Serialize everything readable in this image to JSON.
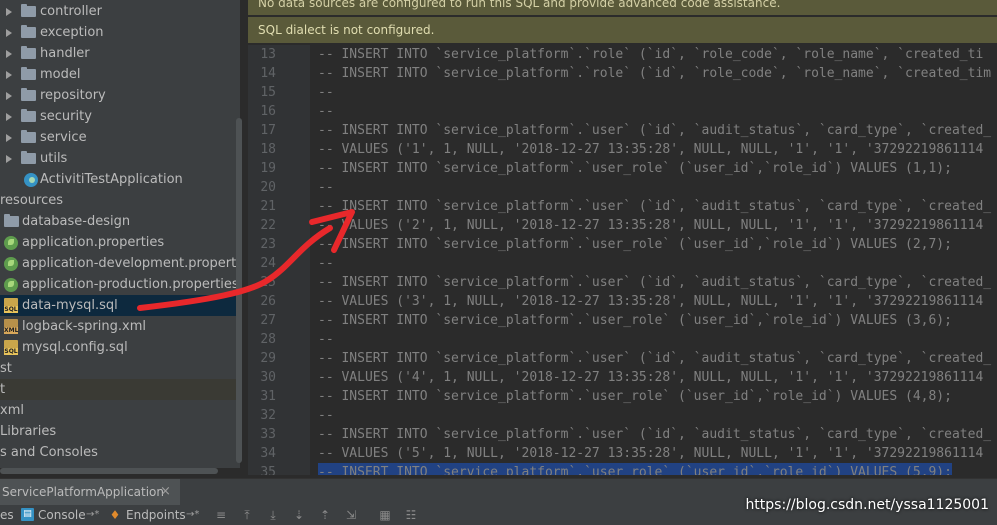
{
  "tree": {
    "items": [
      {
        "label": "controller",
        "icon": "folder",
        "arrow": true
      },
      {
        "label": "exception",
        "icon": "folder",
        "arrow": true
      },
      {
        "label": "handler",
        "icon": "folder",
        "arrow": true
      },
      {
        "label": "model",
        "icon": "folder",
        "arrow": true
      },
      {
        "label": "repository",
        "icon": "folder",
        "arrow": true
      },
      {
        "label": "security",
        "icon": "folder",
        "arrow": true
      },
      {
        "label": "service",
        "icon": "folder",
        "arrow": true
      },
      {
        "label": "utils",
        "icon": "folder",
        "arrow": true
      },
      {
        "label": "ActivitiTestApplication",
        "icon": "spring-class"
      },
      {
        "label": "resources",
        "icon": "none"
      },
      {
        "label": "database-design",
        "icon": "folder"
      },
      {
        "label": "application.properties",
        "icon": "spring-leaf"
      },
      {
        "label": "application-development.properties",
        "icon": "spring-leaf"
      },
      {
        "label": "application-production.properties",
        "icon": "spring-leaf"
      },
      {
        "label": "data-mysql.sql",
        "icon": "sql",
        "selected": true
      },
      {
        "label": "logback-spring.xml",
        "icon": "xml"
      },
      {
        "label": "mysql.config.sql",
        "icon": "sql"
      },
      {
        "label": "st",
        "icon": "none"
      },
      {
        "label": "t",
        "icon": "none",
        "highlight": true
      },
      {
        "label": "xml",
        "icon": "none"
      },
      {
        "label": "Libraries",
        "icon": "none"
      },
      {
        "label": "s and Consoles",
        "icon": "none"
      }
    ]
  },
  "banners": {
    "top": "No data sources are configured to run this SQL and provide advanced code assistance.",
    "dialect": "SQL dialect is not configured."
  },
  "editor": {
    "lines": [
      {
        "n": "13",
        "text": "-- INSERT INTO `service_platform`.`role` (`id`, `role_code`, `role_name`, `created_ti"
      },
      {
        "n": "14",
        "text": "-- INSERT INTO `service_platform`.`role` (`id`, `role_code`, `role_name`, `created_tim"
      },
      {
        "n": "15",
        "text": "--"
      },
      {
        "n": "16",
        "text": "--"
      },
      {
        "n": "17",
        "text": "-- INSERT INTO `service_platform`.`user` (`id`, `audit_status`, `card_type`, `created_"
      },
      {
        "n": "18",
        "text": "-- VALUES ('1', 1, NULL, '2018-12-27 13:35:28', NULL, NULL, '1', '1', '37292219861114"
      },
      {
        "n": "19",
        "text": "-- INSERT INTO `service_platform`.`user_role` (`user_id`,`role_id`) VALUES (1,1);"
      },
      {
        "n": "20",
        "text": "--"
      },
      {
        "n": "21",
        "text": "-- INSERT INTO `service_platform`.`user` (`id`, `audit_status`, `card_type`, `created_"
      },
      {
        "n": "22",
        "text": "-- VALUES ('2', 1, NULL, '2018-12-27 13:35:28', NULL, NULL, '1', '1', '37292219861114"
      },
      {
        "n": "23",
        "text": "-- INSERT INTO `service_platform`.`user_role` (`user_id`,`role_id`) VALUES (2,7);"
      },
      {
        "n": "24",
        "text": "--"
      },
      {
        "n": "25",
        "text": "-- INSERT INTO `service_platform`.`user` (`id`, `audit_status`, `card_type`, `created_"
      },
      {
        "n": "26",
        "text": "-- VALUES ('3', 1, NULL, '2018-12-27 13:35:28', NULL, NULL, '1', '1', '37292219861114"
      },
      {
        "n": "27",
        "text": "-- INSERT INTO `service_platform`.`user_role` (`user_id`,`role_id`) VALUES (3,6);"
      },
      {
        "n": "28",
        "text": "--"
      },
      {
        "n": "29",
        "text": "-- INSERT INTO `service_platform`.`user` (`id`, `audit_status`, `card_type`, `created_"
      },
      {
        "n": "30",
        "text": "-- VALUES ('4', 1, NULL, '2018-12-27 13:35:28', NULL, NULL, '1', '1', '37292219861114"
      },
      {
        "n": "31",
        "text": "-- INSERT INTO `service_platform`.`user_role` (`user_id`,`role_id`) VALUES (4,8);"
      },
      {
        "n": "32",
        "text": "--"
      },
      {
        "n": "33",
        "text": "-- INSERT INTO `service_platform`.`user` (`id`, `audit_status`, `card_type`, `created_"
      },
      {
        "n": "34",
        "text": "-- VALUES ('5', 1, NULL, '2018-12-27 13:35:28', NULL, NULL, '1', '1', '37292219861114"
      },
      {
        "n": "35",
        "text": "-- INSERT INTO `service_platform`.`user_role` (`user_id`,`role_id`) VALUES (5,9);",
        "selected": true
      }
    ]
  },
  "run_tab": {
    "label": "ServicePlatformApplication",
    "close": "×"
  },
  "toolbar": {
    "es_label": "es",
    "console_label": "Console",
    "console_pin": "→*",
    "endpoints_label": "Endpoints",
    "endpoints_pin": "→*"
  },
  "watermark": "https://blog.csdn.net/yssa1125001",
  "colors": {
    "accent_arrow": "#e8282b",
    "banner": "#5a5a3a",
    "selection": "#214283"
  }
}
